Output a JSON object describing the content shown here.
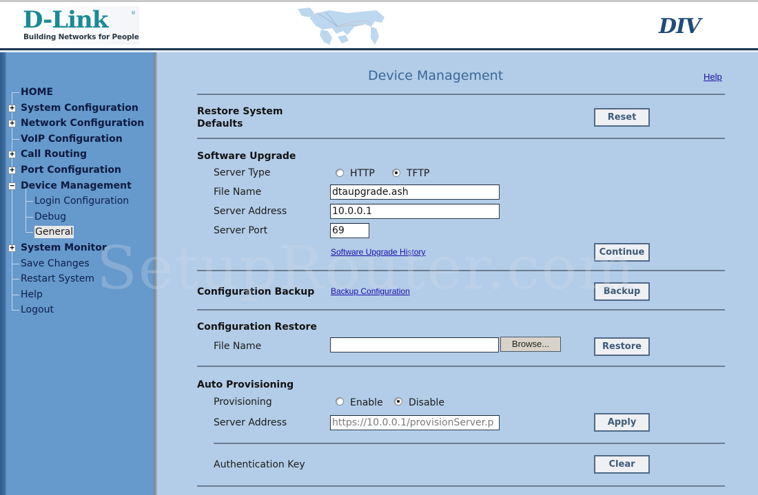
{
  "header": {
    "logo_text": "D-Link",
    "logo_registered": "®",
    "logo_tagline": "Building Networks for People",
    "product_name": "DIV"
  },
  "sidebar": {
    "items": [
      {
        "label": "HOME",
        "bold": true,
        "expander": "none"
      },
      {
        "label": "System Configuration",
        "bold": true,
        "expander": "plus"
      },
      {
        "label": "Network Configuration",
        "bold": true,
        "expander": "plus"
      },
      {
        "label": "VoIP Configuration",
        "bold": true,
        "expander": "none"
      },
      {
        "label": "Call Routing",
        "bold": true,
        "expander": "plus"
      },
      {
        "label": "Port Configuration",
        "bold": true,
        "expander": "plus"
      },
      {
        "label": "Device Management",
        "bold": true,
        "expander": "minus"
      },
      {
        "label": "Login Configuration",
        "bold": false,
        "sub": true
      },
      {
        "label": "Debug",
        "bold": false,
        "sub": true
      },
      {
        "label": "General",
        "bold": false,
        "sub": true,
        "selected": true
      },
      {
        "label": "System Monitor",
        "bold": true,
        "expander": "plus"
      },
      {
        "label": "Save Changes",
        "bold": false,
        "expander": "none"
      },
      {
        "label": "Restart System",
        "bold": false,
        "expander": "none"
      },
      {
        "label": "Help",
        "bold": false,
        "expander": "none"
      },
      {
        "label": "Logout",
        "bold": false,
        "expander": "none"
      }
    ]
  },
  "main": {
    "title": "Device Management",
    "help_link": "Help",
    "restore_defaults": {
      "title_line1": "Restore System",
      "title_line2": "Defaults",
      "button": "Reset"
    },
    "software_upgrade": {
      "title": "Software Upgrade",
      "server_type_label": "Server Type",
      "server_type_options": [
        "HTTP",
        "TFTP"
      ],
      "server_type_selected": "TFTP",
      "file_name_label": "File Name",
      "file_name_value": "dtaupgrade.ash",
      "server_address_label": "Server Address",
      "server_address_value": "10.0.0.1",
      "server_port_label": "Server Port",
      "server_port_value": "69",
      "history_link": "Software Upgrade History",
      "button": "Continue"
    },
    "config_backup": {
      "title": "Configuration Backup",
      "link": "Backup Configuration",
      "button": "Backup"
    },
    "config_restore": {
      "title": "Configuration Restore",
      "file_name_label": "File Name",
      "file_name_value": "",
      "browse_button": "Browse...",
      "button": "Restore"
    },
    "auto_provisioning": {
      "title": "Auto Provisioning",
      "provisioning_label": "Provisioning",
      "provisioning_options": [
        "Enable",
        "Disable"
      ],
      "provisioning_selected": "Disable",
      "server_address_label": "Server Address",
      "server_address_value": "https://10.0.0.1/provisionServer.p",
      "apply_button": "Apply",
      "auth_key_label": "Authentication Key",
      "clear_button": "Clear"
    }
  },
  "watermark": "SetupRouter.com",
  "colors": {
    "sidebar_bg": "#6699cc",
    "content_bg": "#b3cde8",
    "brand_teal": "#1a8a95",
    "title_blue": "#3a6796",
    "link_blue": "#1a0dab"
  }
}
